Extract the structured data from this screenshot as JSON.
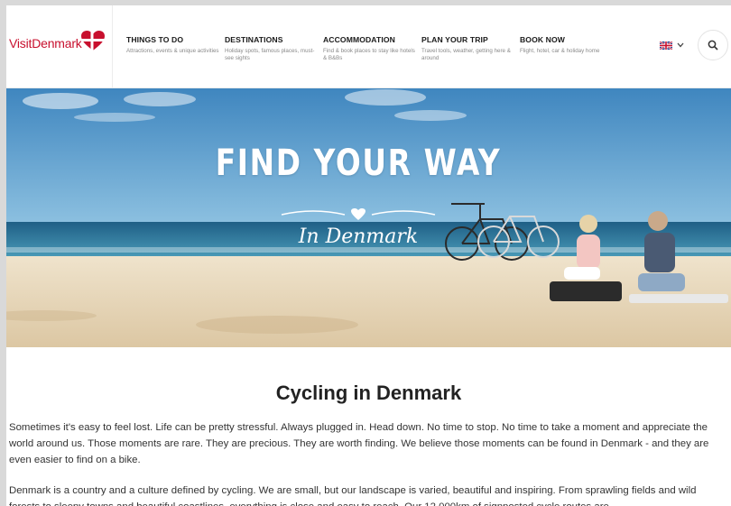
{
  "header": {
    "logo_text": "VisitDenmark",
    "nav": [
      {
        "title": "THINGS TO DO",
        "subtitle": "Attractions, events & unique activities"
      },
      {
        "title": "DESTINATIONS",
        "subtitle": "Holiday spots, famous places, must-see sights"
      },
      {
        "title": "ACCOMMODATION",
        "subtitle": "Find & book places to stay like hotels & B&Bs"
      },
      {
        "title": "PLAN YOUR TRIP",
        "subtitle": "Travel tools, weather, getting here & around"
      },
      {
        "title": "BOOK NOW",
        "subtitle": "Flight, hotel, car & holiday home"
      }
    ],
    "language_icon": "uk-flag-icon",
    "search_icon": "search-icon"
  },
  "hero": {
    "title": "FIND YOUR WAY",
    "subtitle": "In Denmark"
  },
  "content": {
    "title": "Cycling in Denmark",
    "paragraph1": "Sometimes it's easy to feel lost. Life can be pretty stressful. Always plugged in. Head down. No time to stop. No time to take a moment and appreciate the world around us. Those moments are rare. They are precious. They are worth finding. We believe those moments can be found in Denmark - and they are even easier to find on a bike.",
    "paragraph2": "Denmark is a country and a culture defined by cycling. We are small, but our landscape is varied, beautiful and inspiring. From sprawling fields and wild forests to sleepy towns and beautiful coastlines, everything is close and easy to reach. Our 12,000km of signposted cycle routes are"
  },
  "colors": {
    "brand_red": "#c8102e",
    "sky": "#4f93c6",
    "sea": "#2f7aa3",
    "sand": "#e6d6bb"
  }
}
